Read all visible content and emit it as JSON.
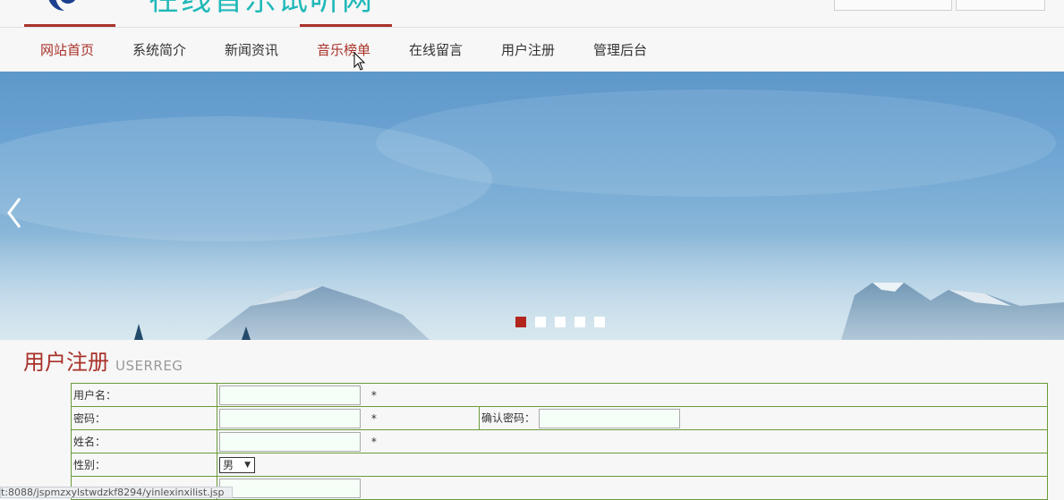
{
  "header": {
    "site_title": "在线音乐试听网"
  },
  "nav": {
    "items": [
      "网站首页",
      "系统简介",
      "新闻资讯",
      "音乐榜单",
      "在线留言",
      "用户注册",
      "管理后台"
    ]
  },
  "banner": {
    "slide_count": 5,
    "active_index": 0,
    "colors": {
      "active_dot": "#b3261e",
      "dot": "#ffffff"
    }
  },
  "register": {
    "title": "用户注册",
    "subtitle": "USERREG",
    "fields": {
      "username_label": "用户名：",
      "password_label": "密码：",
      "confirm_label": "确认密码：",
      "name_label": "姓名：",
      "gender_label": "性别：",
      "gender_value": "男",
      "required_mark": "*"
    }
  },
  "status_bar": {
    "url": "t:8088/jspmzxylstwdzkf8294/yinlexinxilist.jsp"
  },
  "colors": {
    "accent": "#a8322a",
    "title_teal": "#1fb8b8",
    "table_border": "#6a9a3a"
  }
}
